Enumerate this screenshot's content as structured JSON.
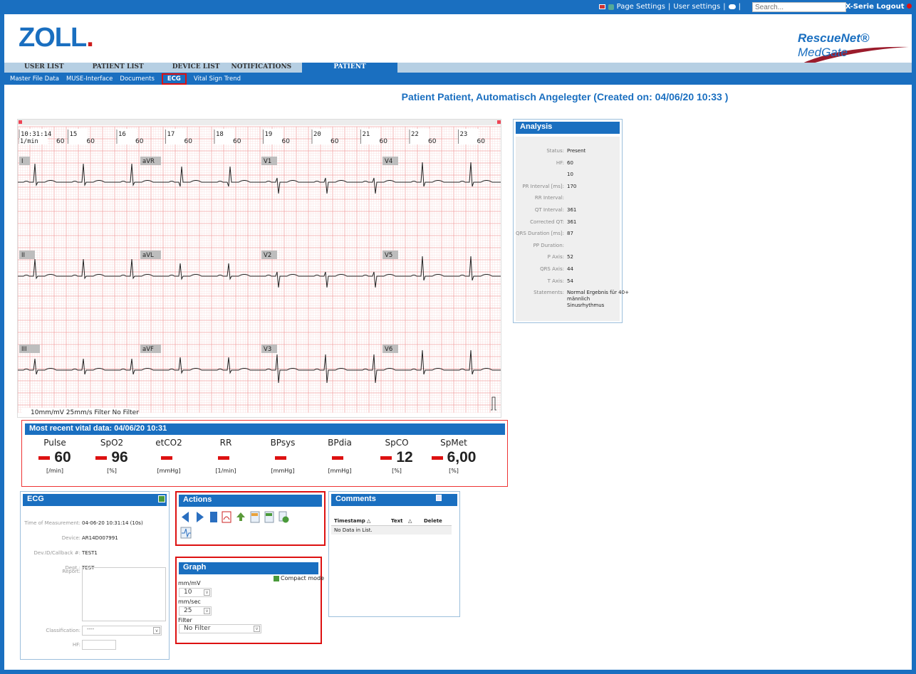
{
  "topbar": {
    "page_settings": "Page Settings",
    "user_settings": "User settings",
    "search_placeholder": "Search...",
    "logout": "X-Serie Logout"
  },
  "logos": {
    "zoll": "ZOLL",
    "medgate_a": "RescueNet",
    "medgate_b": "MedGate"
  },
  "nav": {
    "items": [
      "USER LIST",
      "PATIENT LIST",
      "DEVICE LIST",
      "NOTIFICATIONS"
    ],
    "active": "PATIENT"
  },
  "subnav": [
    "Master File Data",
    "MUSE-Interface",
    "Documents",
    "ECG",
    "Vital Sign Trend"
  ],
  "patient_title": "Patient Patient, Automatisch Angelegter (Created on: 04/06/20 10:33 )",
  "ecg": {
    "time_labels": [
      "10:31:14",
      "15",
      "16",
      "17",
      "18",
      "19",
      "20",
      "21",
      "22",
      "23"
    ],
    "rate_unit": "1/min",
    "rate_values": [
      "60",
      "60",
      "60",
      "60",
      "60",
      "60",
      "60",
      "60",
      "60",
      "60"
    ],
    "leads": [
      [
        "I",
        "aVR",
        "V1",
        "V4"
      ],
      [
        "II",
        "aVL",
        "V2",
        "V5"
      ],
      [
        "III",
        "aVF",
        "V3",
        "V6"
      ]
    ],
    "footer": "10mm/mV  25mm/s  Filter No Filter"
  },
  "vitals": {
    "title": "Most recent vital data: 04/06/20 10:31",
    "items": [
      {
        "name": "Pulse",
        "value": "60",
        "unit": "[/min]"
      },
      {
        "name": "SpO2",
        "value": "96",
        "unit": "[%]"
      },
      {
        "name": "etCO2",
        "value": "",
        "unit": "[mmHg]"
      },
      {
        "name": "RR",
        "value": "",
        "unit": "[1/min]"
      },
      {
        "name": "BPsys",
        "value": "",
        "unit": "[mmHg]"
      },
      {
        "name": "BPdia",
        "value": "",
        "unit": "[mmHg]"
      },
      {
        "name": "SpCO",
        "value": "12",
        "unit": "[%]"
      },
      {
        "name": "SpMet",
        "value": "6,00",
        "unit": "[%]"
      }
    ]
  },
  "analysis": {
    "title": "Analysis",
    "rows": [
      {
        "label": "Status:",
        "value": "Present"
      },
      {
        "label": "HF:",
        "value": "60"
      },
      {
        "label": "",
        "value": "10"
      },
      {
        "label": "PR Interval [ms]:",
        "value": "170"
      },
      {
        "label": "RR Interval:",
        "value": ""
      },
      {
        "label": "QT Interval:",
        "value": "361"
      },
      {
        "label": "Corrected QT:",
        "value": "361"
      },
      {
        "label": "QRS Duration [ms]:",
        "value": "87"
      },
      {
        "label": "PP Duration:",
        "value": ""
      },
      {
        "label": "P Axis:",
        "value": "52"
      },
      {
        "label": "QRS Axis:",
        "value": "44"
      },
      {
        "label": "T Axis:",
        "value": "54"
      }
    ],
    "statements_label": "Statements:",
    "statements": [
      "Normal Ergebnis für 40+",
      "männlich",
      "Sinusrhythmus"
    ]
  },
  "ecg_info": {
    "title": "ECG",
    "rows": [
      {
        "label": "Time of Measurement:",
        "value": "04-06-20 10:31:14 (10s)"
      },
      {
        "label": "Device:",
        "value": "AR14D007991"
      },
      {
        "label": "Dev.ID/Callback #:",
        "value": "TEST1"
      },
      {
        "label": "Dept.:",
        "value": "TEST"
      }
    ],
    "report_label": "Report:",
    "classification_label": "Classification:",
    "classification_value": "----",
    "hf_label": "HF:"
  },
  "actions": {
    "title": "Actions"
  },
  "graph": {
    "title": "Graph",
    "compact_label": "Compact mode",
    "mmmv_label": "mm/mV",
    "mmmv_value": "10",
    "mmsec_label": "mm/sec",
    "mmsec_value": "25",
    "filter_label": "Filter",
    "filter_value": "No Filter"
  },
  "comments": {
    "title": "Comments",
    "columns": [
      "Timestamp",
      "Text",
      "Delete"
    ],
    "empty": "No Data in List."
  },
  "colors": {
    "brand": "#1a6fc0",
    "alert": "#dd1111",
    "grid": "#f2a5a5"
  }
}
